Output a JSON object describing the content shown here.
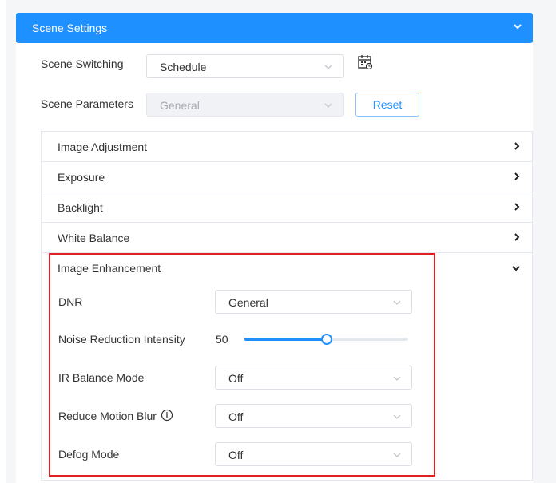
{
  "header": {
    "title": "Scene Settings",
    "icon": "chevron-down-icon"
  },
  "scene_switching": {
    "label": "Scene Switching",
    "value": "Schedule",
    "icon": "calendar-icon"
  },
  "scene_parameters": {
    "label": "Scene Parameters",
    "value": "General",
    "reset_label": "Reset"
  },
  "sections": {
    "image_adjustment": "Image Adjustment",
    "exposure": "Exposure",
    "backlight": "Backlight",
    "white_balance": "White Balance",
    "image_enhancement": "Image Enhancement"
  },
  "enhancement": {
    "dnr": {
      "label": "DNR",
      "value": "General"
    },
    "noise": {
      "label": "Noise Reduction Intensity",
      "value": "50",
      "level_percent": 50
    },
    "ir_balance": {
      "label": "IR Balance Mode",
      "value": "Off"
    },
    "motion_blur": {
      "label": "Reduce Motion Blur",
      "value": "Off",
      "icon": "info-icon"
    },
    "defog": {
      "label": "Defog Mode",
      "value": "Off"
    }
  },
  "colors": {
    "accent": "#1e90ff",
    "highlight": "#e02020"
  }
}
